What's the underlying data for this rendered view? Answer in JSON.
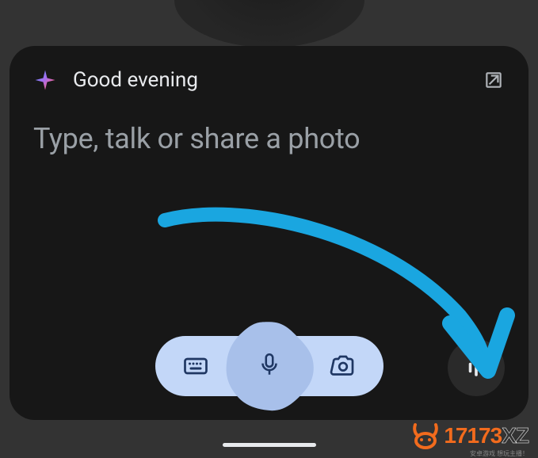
{
  "header": {
    "greeting": "Good evening"
  },
  "input": {
    "placeholder": "Type, talk or share a photo"
  },
  "icons": {
    "sparkle": "sparkle-icon",
    "expand": "open-in-new-icon",
    "keyboard": "keyboard-icon",
    "mic": "microphone-icon",
    "camera": "camera-icon",
    "live": "sound-bars-sparkle-icon"
  },
  "colors": {
    "panel_bg": "#171717",
    "pill_bg": "#c3d7f8",
    "mic_blob": "#a8c0ea",
    "icon_dark": "#1f3763",
    "text_light": "#e8eaed",
    "placeholder": "#9aa0a6",
    "accent_annotation": "#1aa6e0",
    "watermark_accent": "#f26b1d"
  },
  "watermark": {
    "part1": "17173",
    "part2": "XZ",
    "sub": "安卓游戏 想玩主播！"
  }
}
